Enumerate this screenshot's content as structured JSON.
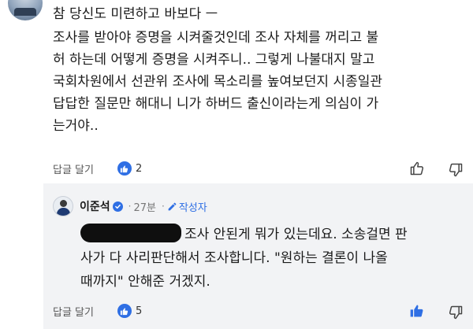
{
  "comment": {
    "lines": [
      "참 당신도 미련하고 바보다 ㅡ",
      "조사를 받아야 증명을 시켜줄것인데 조사 자체를 꺼리고 불",
      "허 하는데 어떻게 증명을 시켜주니.. 그렇게 나불대지 말고",
      "국회차원에서 선관위 조사에 목소리를 높여보던지 시종일관",
      "답답한 질문만 해대니 니가 하버드 출신이라는게 의심이 가",
      "는거야.."
    ],
    "reply_label": "답글 달기",
    "like_count": "2"
  },
  "reply": {
    "author": "이준석",
    "separator": "·",
    "time": "27분",
    "tag_separator": "·",
    "author_tag": "작성자",
    "lines": [
      "조사 안된게 뭐가 있는데요. 소송걸면 판",
      "사가 다 사리판단해서 조사합니다. \"원하는 결론이 나올",
      "때까지\" 안해준 거겠지."
    ],
    "reply_label": "답글 달기",
    "like_count": "5"
  },
  "colors": {
    "accent": "#2f6fe4",
    "reply_bg": "#f2f3f5",
    "muted": "#555555"
  }
}
